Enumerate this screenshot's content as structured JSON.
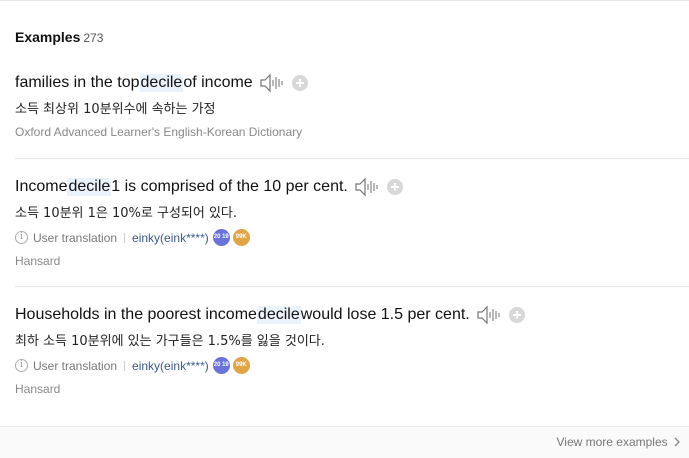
{
  "header": {
    "title": "Examples",
    "count": "273"
  },
  "examples": [
    {
      "pre": "families in the top ",
      "hl": "decile",
      "post": " of income",
      "translation": "소득 최상위 10분위수에 속하는 가정",
      "source": "Oxford Advanced Learner's English-Korean Dictionary"
    },
    {
      "pre": "Income ",
      "hl": "decile",
      "post": " 1 is comprised of the 10 per cent.",
      "translation": "소득 10분위 1은 10%로 구성되어 있다.",
      "meta_label": "User translation",
      "user": "einky(eink****)",
      "badge_rank": "20 19",
      "badge_points": "99K",
      "source": "Hansard"
    },
    {
      "pre": "Households in the poorest income ",
      "hl": "decile",
      "post": " would lose 1.5 per cent.",
      "translation": "최하 소득 10분위에 있는 가구들은 1.5%를 잃을 것이다.",
      "meta_label": "User translation",
      "user": "einky(eink****)",
      "badge_rank": "20 19",
      "badge_points": "99K",
      "source": "Hansard"
    }
  ],
  "footer": {
    "more_label": "View more examples",
    "more_icon": "chevron-right-icon"
  },
  "colors": {
    "highlight": "#eaf3fb",
    "user": "#3a5a8c",
    "badge_rank": "#6b73d9",
    "badge_points": "#e0a449"
  }
}
